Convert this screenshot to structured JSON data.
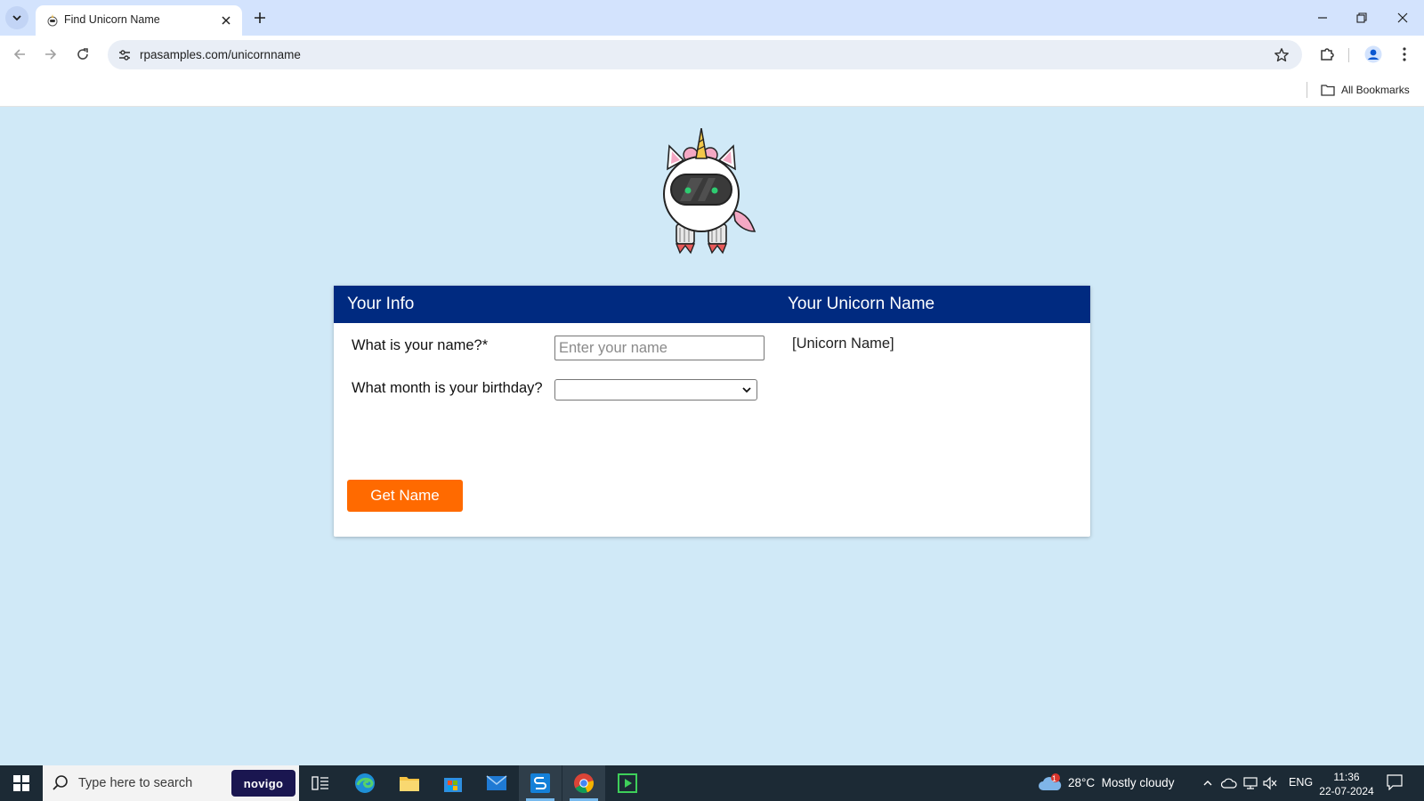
{
  "browser": {
    "tab_title": "Find Unicorn Name",
    "url": "rpasamples.com/unicornname",
    "bookmarks_label": "All Bookmarks"
  },
  "page": {
    "left_header": "Your Info",
    "right_header": "Your Unicorn Name",
    "name_label": "What is your name?*",
    "name_placeholder": "Enter your name",
    "name_value": "",
    "birthday_label": "What month is your birthday?",
    "birthday_selected": "",
    "result": "[Unicorn Name]",
    "button_label": "Get Name"
  },
  "colors": {
    "page_bg": "#d0e9f7",
    "header_bg": "#002a80",
    "button_bg": "#ff6a00"
  },
  "taskbar": {
    "search_placeholder": "Type here to search",
    "novigo_label": "novigo",
    "weather": "28°C  Mostly cloudy",
    "weather_badge": "1",
    "language": "ENG",
    "time": "11:36",
    "date": "22-07-2024"
  }
}
